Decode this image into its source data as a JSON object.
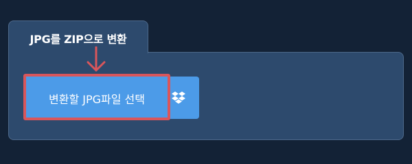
{
  "tab": {
    "title": "JPG를 ZIP으로 변환"
  },
  "upload": {
    "select_label": "변환할 JPG파일 선택",
    "dropbox_icon": "dropbox-icon",
    "arrow_icon": "arrow-down-icon"
  },
  "colors": {
    "page_background": "#132236",
    "panel_background": "#2d4a6d",
    "button_background": "#4c9be8",
    "highlight_red": "#d9565b",
    "text": "#ffffff"
  }
}
